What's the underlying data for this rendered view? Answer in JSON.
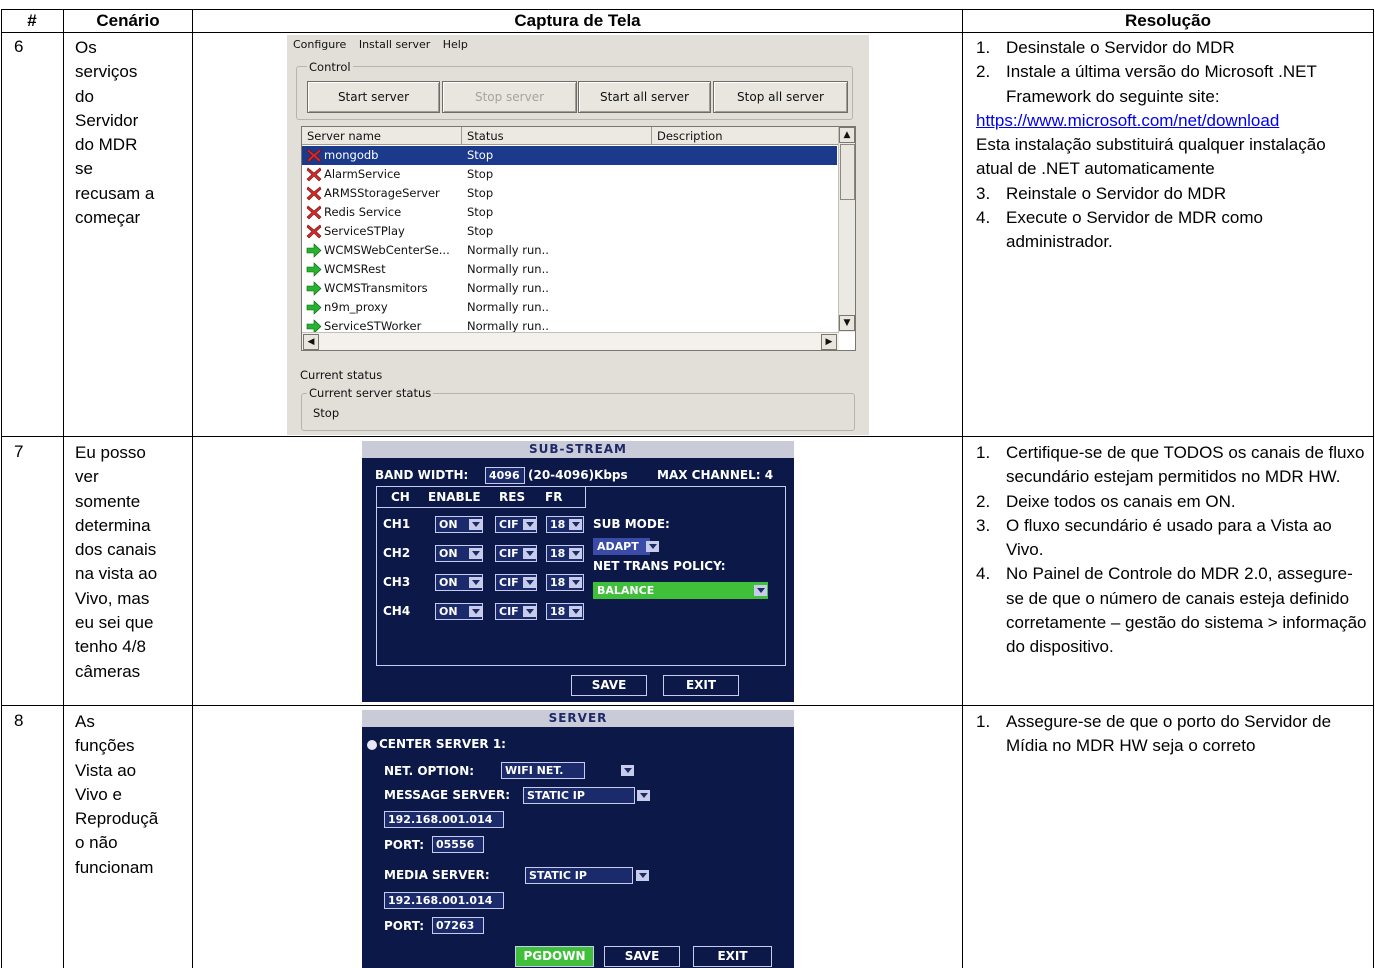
{
  "table": {
    "headers": {
      "number": "#",
      "scenario": "Cenário",
      "screenshot": "Captura de Tela",
      "resolution": "Resolução"
    },
    "rows": [
      {
        "number": "6",
        "scenario": "Os\nserviços\ndo\nServidor\ndo MDR\nse\nrecusam a\ncomeçar",
        "resolution": {
          "step1": "Desinstale o Servidor do MDR",
          "step2": "Instale a última versão do Microsoft .NET Framework do seguinte site:",
          "link": "https://www.microsoft.com/net/download",
          "note": "Esta instalação substituirá qualquer instalação atual de .NET automaticamente",
          "step3": "Reinstale o Servidor do MDR",
          "step4": "Execute o Servidor de MDR como administrador."
        }
      },
      {
        "number": "7",
        "scenario": "Eu posso\nver\nsomente\ndetermina\ndos canais\nna vista ao\nVivo, mas\neu sei que\ntenho 4/8\ncâmeras",
        "resolution": {
          "step1": "Certifique-se de que TODOS os canais de fluxo secundário estejam permitidos no MDR HW.",
          "step2": "Deixe todos os canais em ON.",
          "step3": "O fluxo secundário é usado para a Vista ao Vivo.",
          "step4": "No Painel de Controle do MDR 2.0, assegure-se de que o número de canais esteja definido corretamente – gestão do sistema > informação do dispositivo."
        }
      },
      {
        "number": "8",
        "scenario": "As\nfunções\nVista ao\nVivo e\nReproduçã\no não\nfuncionam",
        "resolution": {
          "step1": "Assegure-se de que o porto do Servidor de Mídia no MDR HW seja o correto"
        }
      }
    ],
    "step_numbers": [
      "1.",
      "2.",
      "3.",
      "4."
    ]
  },
  "server_manager": {
    "menu": [
      "Configure",
      "Install server",
      "Help"
    ],
    "control_label": "Control",
    "buttons": [
      "Start server",
      "Stop server",
      "Start all server",
      "Stop all server"
    ],
    "columns": [
      "Server name",
      "Status",
      "Description"
    ],
    "services": [
      {
        "name": "mongodb",
        "status": "Stop",
        "icon": "stopped-x-icon"
      },
      {
        "name": "AlarmService",
        "status": "Stop",
        "icon": "stopped-x-icon"
      },
      {
        "name": "ARMSStorageServer",
        "status": "Stop",
        "icon": "stopped-x-icon"
      },
      {
        "name": "Redis Service",
        "status": "Stop",
        "icon": "stopped-x-icon"
      },
      {
        "name": "ServiceSTPlay",
        "status": "Stop",
        "icon": "stopped-x-icon"
      },
      {
        "name": "WCMSWebCenterSe...",
        "status": "Normally run..",
        "icon": "running-arrow-icon"
      },
      {
        "name": "WCMSRest",
        "status": "Normally run..",
        "icon": "running-arrow-icon"
      },
      {
        "name": "WCMSTransmitors",
        "status": "Normally run..",
        "icon": "running-arrow-icon"
      },
      {
        "name": "n9m_proxy",
        "status": "Normally run..",
        "icon": "running-arrow-icon"
      },
      {
        "name": "ServiceSTWorker",
        "status": "Normally run..",
        "icon": "running-arrow-icon"
      }
    ],
    "current_status_label": "Current status",
    "current_server_status_label": "Current server status",
    "current_server_status": "Stop"
  },
  "sub_stream": {
    "title": "SUB-STREAM",
    "band_width_label": "BAND WIDTH:",
    "band_width_value": "4096",
    "band_width_range": "(20-4096)Kbps",
    "max_channel": "MAX CHANNEL: 4",
    "columns": [
      "CH",
      "ENABLE",
      "RES",
      "FR"
    ],
    "channels": [
      {
        "ch": "CH1",
        "enable": "ON",
        "res": "CIF",
        "fr": "18"
      },
      {
        "ch": "CH2",
        "enable": "ON",
        "res": "CIF",
        "fr": "18"
      },
      {
        "ch": "CH3",
        "enable": "ON",
        "res": "CIF",
        "fr": "18"
      },
      {
        "ch": "CH4",
        "enable": "ON",
        "res": "CIF",
        "fr": "18"
      }
    ],
    "sub_mode_label": "SUB MODE:",
    "sub_mode_value": "ADAPT",
    "policy_label": "NET TRANS POLICY:",
    "policy_value": "BALANCE",
    "save": "SAVE",
    "exit": "EXIT"
  },
  "server_screen": {
    "title": "SERVER",
    "center_server": "CENTER SERVER 1:",
    "net_option_label": "NET. OPTION:",
    "net_option_value": "WIFI NET.",
    "message_server_label": "MESSAGE SERVER:",
    "message_server_value": "STATIC IP",
    "message_ip": "192.168.001.014",
    "port_label": "PORT:",
    "message_port": "05556",
    "media_server_label": "MEDIA SERVER:",
    "media_server_value": "STATIC IP",
    "media_ip": "192.168.001.014",
    "media_port": "07263",
    "pgdown": "PGDOWN",
    "save": "SAVE",
    "exit": "EXIT"
  }
}
